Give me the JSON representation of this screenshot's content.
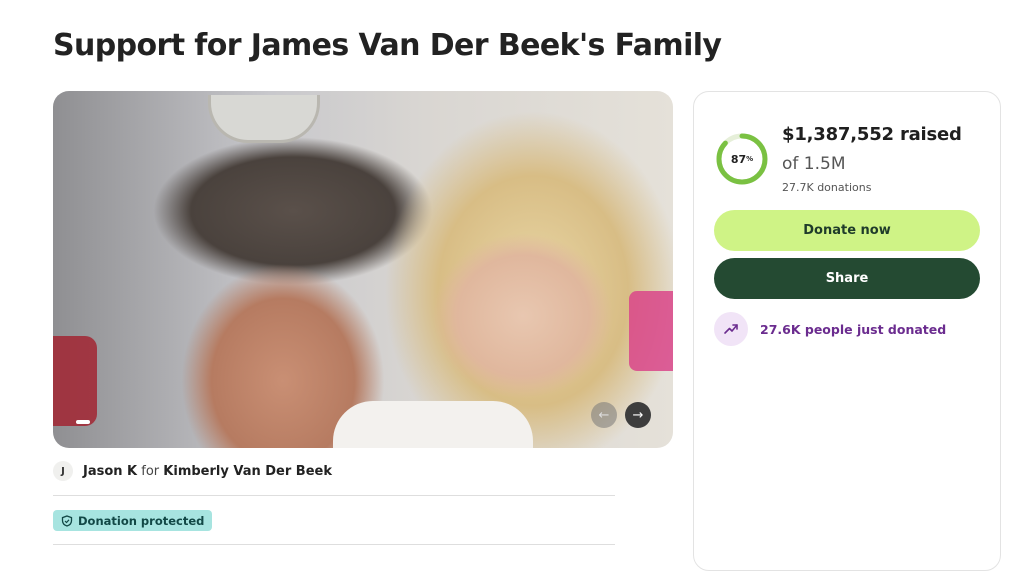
{
  "page": {
    "title": "Support for James Van Der Beek's Family"
  },
  "organizer": {
    "avatar_initial": "J",
    "name": "Jason K",
    "for_label": "for",
    "beneficiary": "Kimberly Van Der Beek"
  },
  "badge": {
    "label": "Donation protected"
  },
  "carousel": {
    "prev_icon": "arrow-left-icon",
    "next_icon": "arrow-right-icon",
    "prev_glyph": "←",
    "next_glyph": "→"
  },
  "donation": {
    "progress_percent": 87,
    "progress_label": "87",
    "percent_sign": "%",
    "raised": "$1,387,552 raised",
    "goal": "of 1.5M",
    "count": "27.7K donations",
    "donate_label": "Donate now",
    "share_label": "Share",
    "trend_text": "27.6K people just donated"
  },
  "colors": {
    "progress": "#7ac142",
    "progress_track": "#e6efd9",
    "donate_bg": "#cff386",
    "share_bg": "#244a32",
    "badge_bg": "#a7e4e0",
    "trend": "#6b2c8f"
  }
}
